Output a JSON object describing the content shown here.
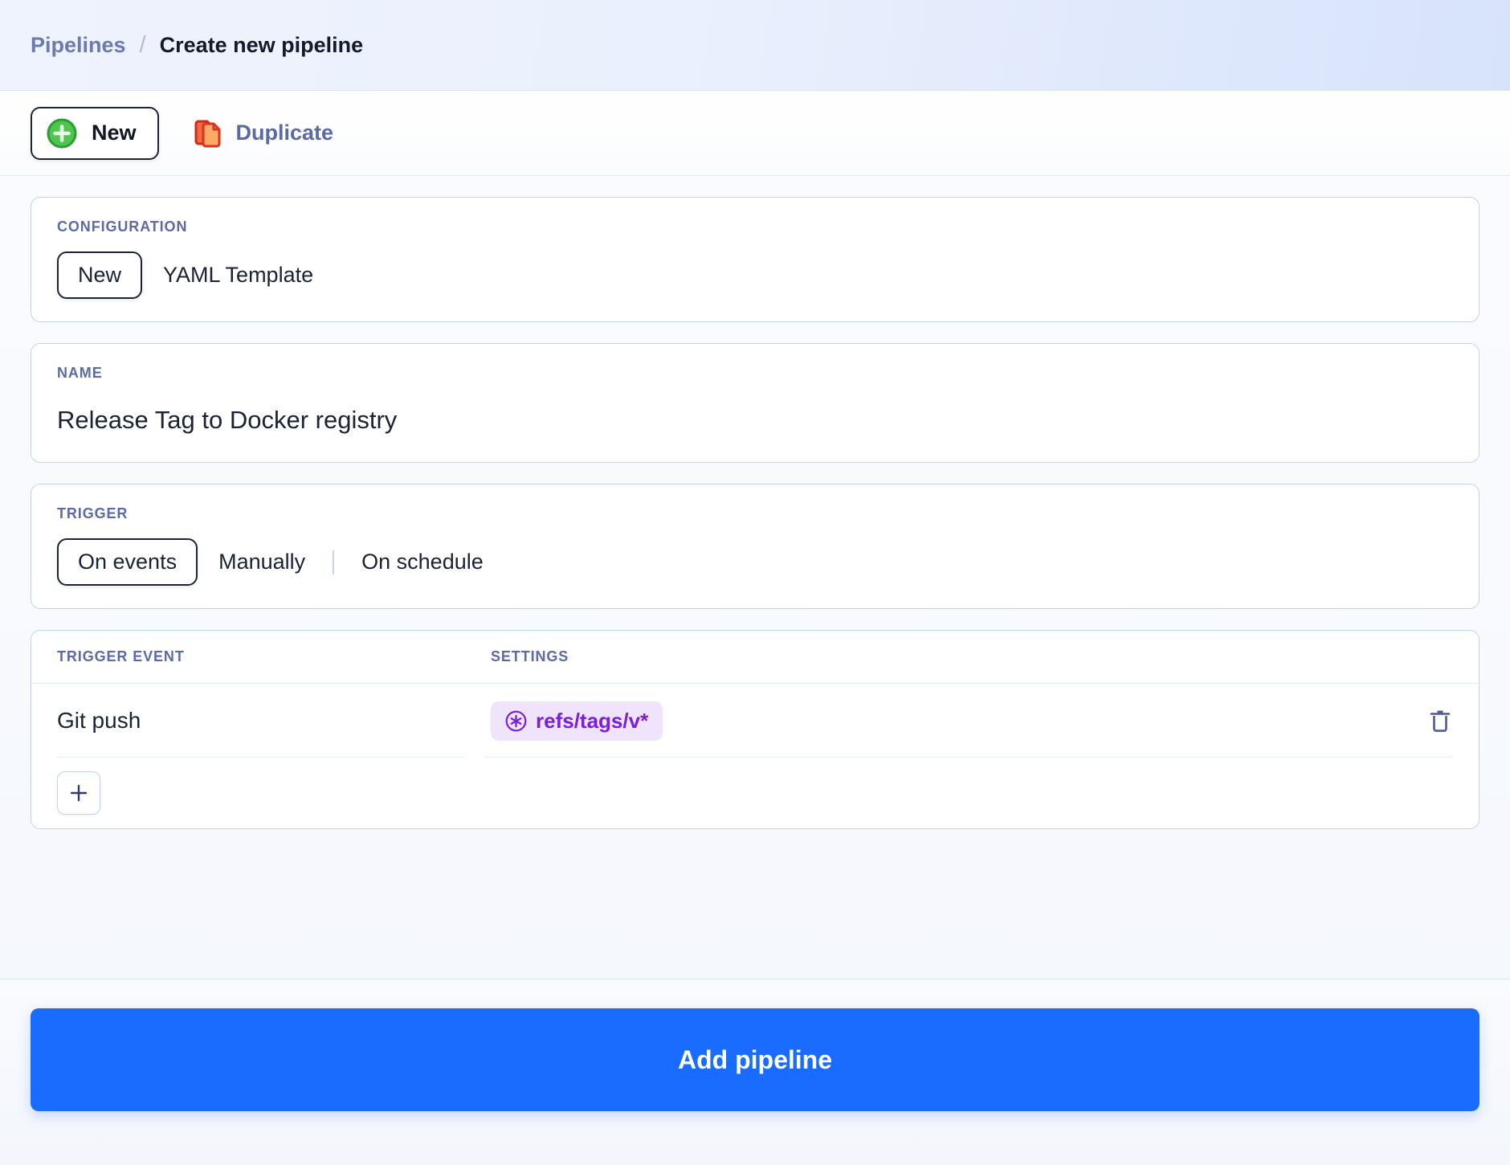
{
  "breadcrumb": {
    "parent": "Pipelines",
    "separator": "/",
    "current": "Create new pipeline"
  },
  "toolbar": {
    "new_label": "New",
    "new_icon": "plus-circle-icon",
    "duplicate_label": "Duplicate",
    "duplicate_icon": "duplicate-documents-icon"
  },
  "configuration": {
    "label": "CONFIGURATION",
    "options": [
      {
        "label": "New",
        "selected": true
      },
      {
        "label": "YAML Template",
        "selected": false
      }
    ]
  },
  "name": {
    "label": "NAME",
    "value": "Release Tag to Docker registry",
    "placeholder": "Pipeline name"
  },
  "trigger": {
    "label": "TRIGGER",
    "options": [
      {
        "label": "On events",
        "selected": true
      },
      {
        "label": "Manually",
        "selected": false
      },
      {
        "label": "On schedule",
        "selected": false
      }
    ]
  },
  "trigger_events_table": {
    "columns": {
      "trigger_event": "TRIGGER EVENT",
      "settings": "SETTINGS"
    },
    "rows": [
      {
        "trigger_event": "Git push",
        "settings_badge": "refs/tags/v*",
        "settings_badge_icon": "asterisk-circle-icon",
        "delete_icon": "trash-icon"
      }
    ],
    "add_row_icon": "plus-icon"
  },
  "footer": {
    "submit_label": "Add pipeline"
  },
  "colors": {
    "accent_blue": "#1a6bff",
    "badge_purple_text": "#7a20d9",
    "badge_purple_bg": "#f0e4fd",
    "label_slate": "#5b6ba4",
    "link_slate": "#5a6aa3",
    "new_icon_green": "#3fbf3f",
    "duplicate_icon_red": "#dc3221",
    "duplicate_icon_orange": "#fbab66",
    "card_border": "#c3d4f2"
  }
}
